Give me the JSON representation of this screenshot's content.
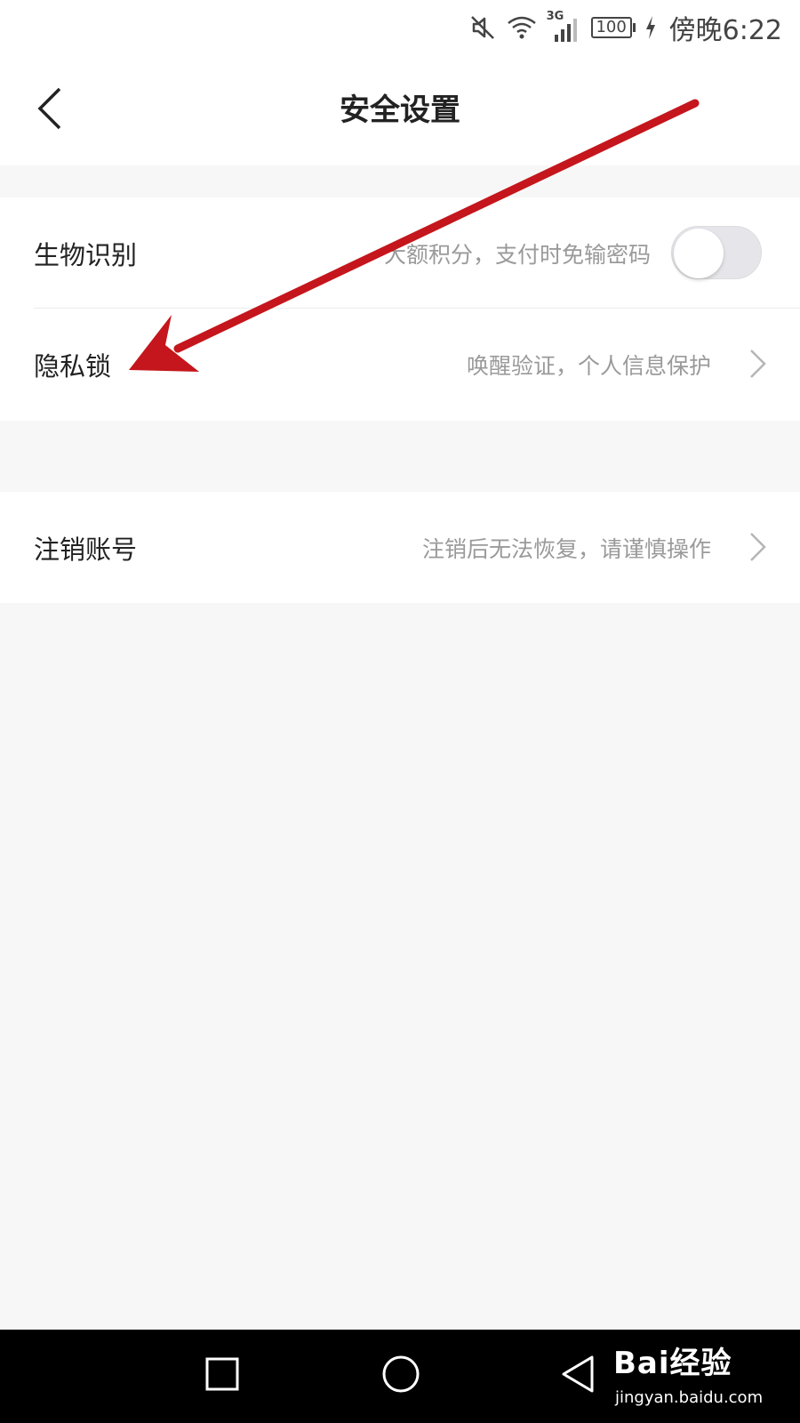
{
  "status_bar": {
    "icons": [
      "mute-icon",
      "wifi-icon",
      "cellular-3g-icon",
      "battery-icon",
      "charging-icon"
    ],
    "network_label": "3G",
    "battery_level": "100",
    "time": "傍晚6:22"
  },
  "header": {
    "back_icon": "chevron-left-icon",
    "title": "安全设置"
  },
  "settings": {
    "biometric": {
      "label": "生物识别",
      "description": "大额积分，支付时免输密码",
      "toggle_on": false
    },
    "privacy_lock": {
      "label": "隐私锁",
      "description": "唤醒验证，个人信息保护",
      "icon": "chevron-right-icon"
    },
    "delete_account": {
      "label": "注销账号",
      "description": "注销后无法恢复，请谨慎操作",
      "icon": "chevron-right-icon"
    }
  },
  "nav_bar": {
    "icons": [
      "recent-apps-icon",
      "home-icon",
      "back-triangle-icon"
    ]
  },
  "watermark": {
    "brand": "Bai经验",
    "url": "jingyan.baidu.com"
  },
  "colors": {
    "background": "#f7f7f7",
    "card": "#ffffff",
    "text_primary": "#222222",
    "text_secondary": "#9a9a9a",
    "toggle_off": "#e6e6ea",
    "annotation_arrow": "#c4161c",
    "nav_bar": "#000000"
  }
}
